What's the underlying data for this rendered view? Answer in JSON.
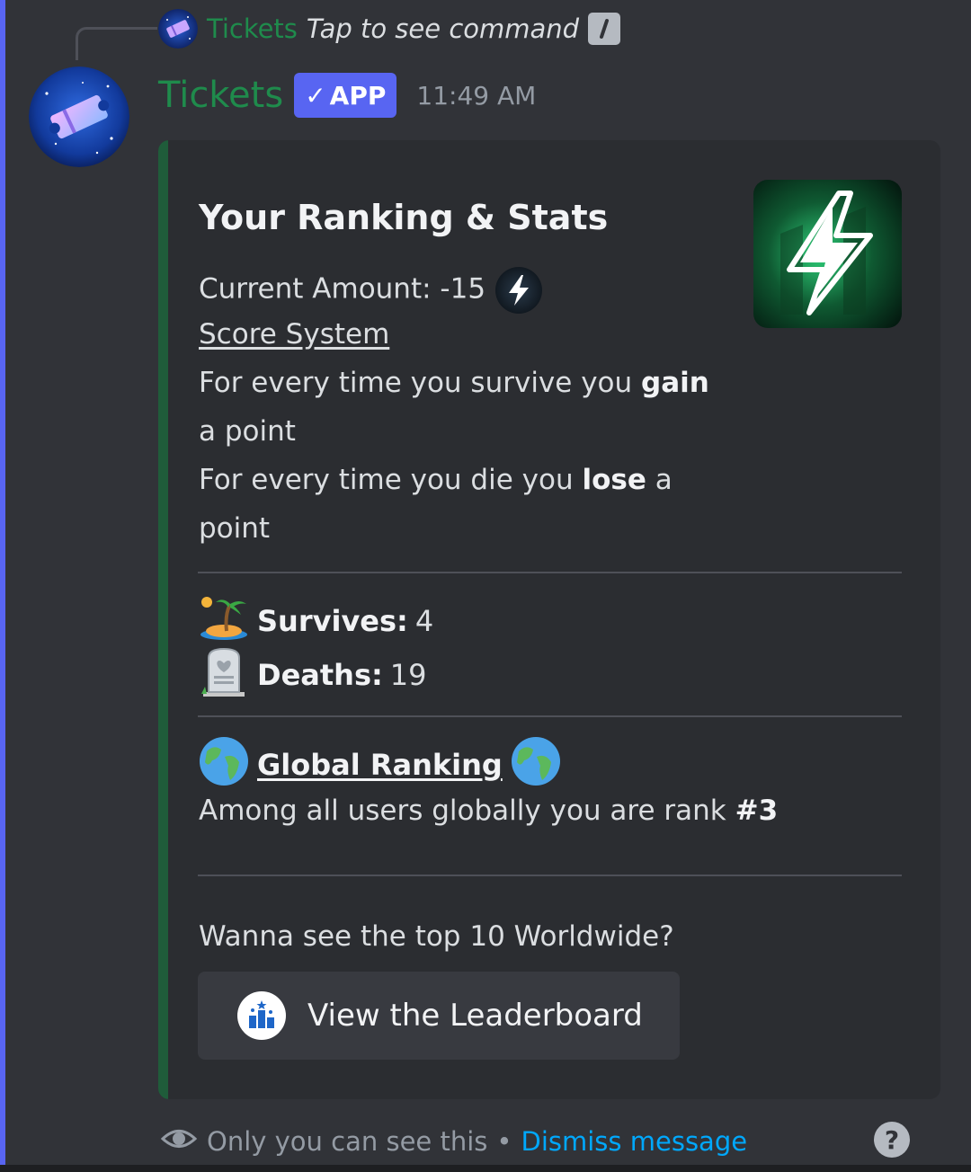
{
  "reply": {
    "bot_name": "Tickets",
    "command_hint": "Tap to see command"
  },
  "message": {
    "author": "Tickets",
    "badge": "APP",
    "timestamp": "11:49 AM"
  },
  "embed": {
    "title": "Your Ranking & Stats",
    "current_amount_label": "Current Amount: -15",
    "score_system_link": "Score System",
    "gain_line1_pre": "For every time you survive you",
    "gain_word": "gain",
    "gain_line2": "a point",
    "lose_pre": "For every time you die you",
    "lose_word": "lose",
    "lose_post": "a",
    "lose_line2": "point",
    "survives_label": "Survives:",
    "survives_value": "4",
    "deaths_label": "Deaths:",
    "deaths_value": "19",
    "global_ranking_title": "Global Ranking",
    "rank_text_pre": "Among all users globally you are rank",
    "rank_value": "#3",
    "top10_prompt": "Wanna see the top 10 Worldwide?",
    "button_label": "View the Leaderboard"
  },
  "footer": {
    "visibility_note": "Only you can see this",
    "separator": "•",
    "dismiss_link": "Dismiss message",
    "help_glyph": "?"
  },
  "colors": {
    "background": "#313338",
    "embed_bg": "#2b2d31",
    "embed_accent": "#1f5c3a",
    "author_color": "#1f8b4c",
    "badge_color": "#5865f2",
    "link_color": "#00a8fc"
  }
}
